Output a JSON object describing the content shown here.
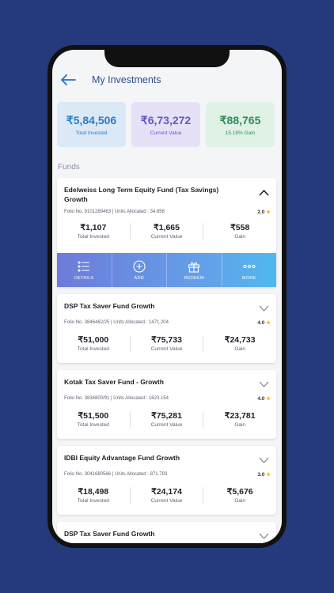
{
  "header": {
    "title": "My Investments"
  },
  "summary": [
    {
      "value": "₹5,84,506",
      "label": "Total Invested"
    },
    {
      "value": "₹6,73,272",
      "label": "Current Value"
    },
    {
      "value": "₹88,765",
      "label": "15.19% Gain"
    }
  ],
  "funds_label": "Funds",
  "actions": [
    {
      "label": "DETAILS"
    },
    {
      "label": "ADD"
    },
    {
      "label": "REDEEM"
    },
    {
      "label": "MORE"
    }
  ],
  "funds": [
    {
      "name": "Edelweiss Long Term Equity Fund (Tax Savings) Growth",
      "folio": "Folio No. 9101269463 | Units Allocated : 34.858",
      "rating": "2.0",
      "invested": "₹1,107",
      "current": "₹1,665",
      "gain": "₹558"
    },
    {
      "name": "DSP Tax Saver Fund Growth",
      "folio": "Folio No. 3846462/25 | Units Allocated : 1471.204",
      "rating": "4.0",
      "invested": "₹51,000",
      "current": "₹75,733",
      "gain": "₹24,733"
    },
    {
      "name": "Kotak Tax Saver Fund - Growth",
      "folio": "Folio No. 3834800/91 | Units Allocated : 1623.154",
      "rating": "4.0",
      "invested": "₹51,500",
      "current": "₹75,281",
      "gain": "₹23,781"
    },
    {
      "name": "IDBI Equity Advantage Fund Growth",
      "folio": "Folio No. 3041680566 | Units Allocated : 871.793",
      "rating": "3.0",
      "invested": "₹18,498",
      "current": "₹24,174",
      "gain": "₹5,676"
    },
    {
      "name": "DSP Tax Saver Fund Growth"
    }
  ],
  "metric_labels": {
    "invested": "Total Invested",
    "current": "Current Value",
    "gain": "Gain"
  },
  "colors": {
    "background": "#253a7d",
    "accent": "#2a4f94",
    "gain": "#2e8c56",
    "star": "#f2b90f"
  }
}
